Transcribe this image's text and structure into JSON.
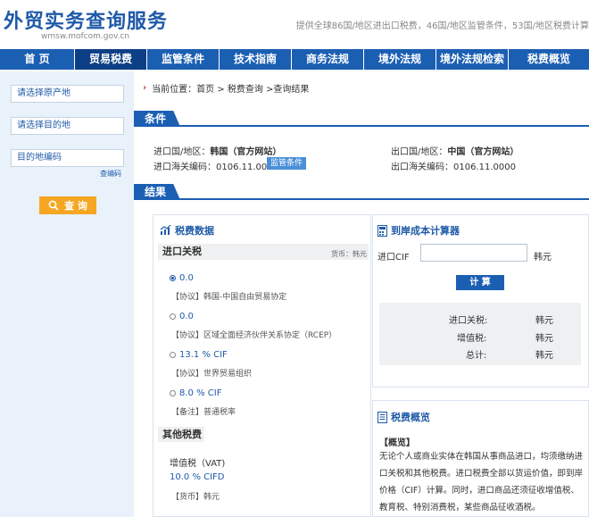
{
  "header": {
    "logo": "外贸实务查询服务",
    "url": "wmsw.mofcom.gov.cn",
    "tagline": "提供全球86国/地区进出口税费，46国/地区监管条件，53国/地区税费计算"
  },
  "nav": {
    "items": [
      "首 页",
      "贸易税费",
      "监管条件",
      "技术指南",
      "商务法规",
      "境外法规",
      "境外法规检索",
      "税费概览"
    ],
    "active_index": 1
  },
  "sidebar": {
    "origin_placeholder": "请选择原产地",
    "destination_placeholder": "请选择目的地",
    "code_placeholder": "目的地编码",
    "code_link": "查编码",
    "query_button": "查 询"
  },
  "breadcrumb": {
    "prefix": "当前位置：",
    "path": "首页 > 税费查询 >查询结果"
  },
  "condition": {
    "tab": "条件",
    "import_country_label": "进口国/地区：",
    "import_country": "韩国（官方网站）",
    "export_country_label": "出口国/地区：",
    "export_country": "中国（官方网站）",
    "import_code_label": "进口海关编码：",
    "import_code": "0106.11.0000",
    "export_code_label": "出口海关编码：",
    "export_code": "0106.11.0000",
    "supervision_badge": "监管条件"
  },
  "results": {
    "tab": "结果",
    "tax_data_title": "税费数据",
    "import_tariff_head": "进口关税",
    "currency_note": "货币：韩元",
    "rates": [
      {
        "value": "0.0",
        "note": "【协议】韩国-中国自由贸易协定",
        "selected": true
      },
      {
        "value": "0.0",
        "note": "【协议】区域全面经济伙伴关系协定（RCEP）",
        "selected": false
      },
      {
        "value": "13.1 % CIF",
        "note": "【协议】世界贸易组织",
        "selected": false
      },
      {
        "value": "8.0 % CIF",
        "note": "【备注】普通税率",
        "selected": false
      }
    ],
    "other_tax_head": "其他税费",
    "vat_label": "增值税（VAT)",
    "vat_rate": "10.0 % CIFD",
    "vat_currency": "【货币】韩元"
  },
  "calculator": {
    "title": "到岸成本计算器",
    "cif_label": "进口CIF",
    "unit": "韩元",
    "button": "计 算",
    "rows": [
      {
        "label": "进口关税:",
        "value": "韩元"
      },
      {
        "label": "增值税:",
        "value": "韩元"
      },
      {
        "label": "总计:",
        "value": "韩元"
      }
    ]
  },
  "overview": {
    "title": "税费概览",
    "head": "【概览】",
    "text": "无论个人或商业实体在韩国从事商品进口，均须缴纳进口关税和其他税费。进口税费全部以货运价值，即到岸价格（CIF）计算。同时，进口商品还须征收增值税、教育税、特别消费税，某些商品征收酒税。"
  },
  "colors": {
    "brand_blue": "#1b5fb3",
    "nav_active": "#0d3f86",
    "query_orange": "#f5a623",
    "sidebar_bg": "#e9f1fb"
  }
}
